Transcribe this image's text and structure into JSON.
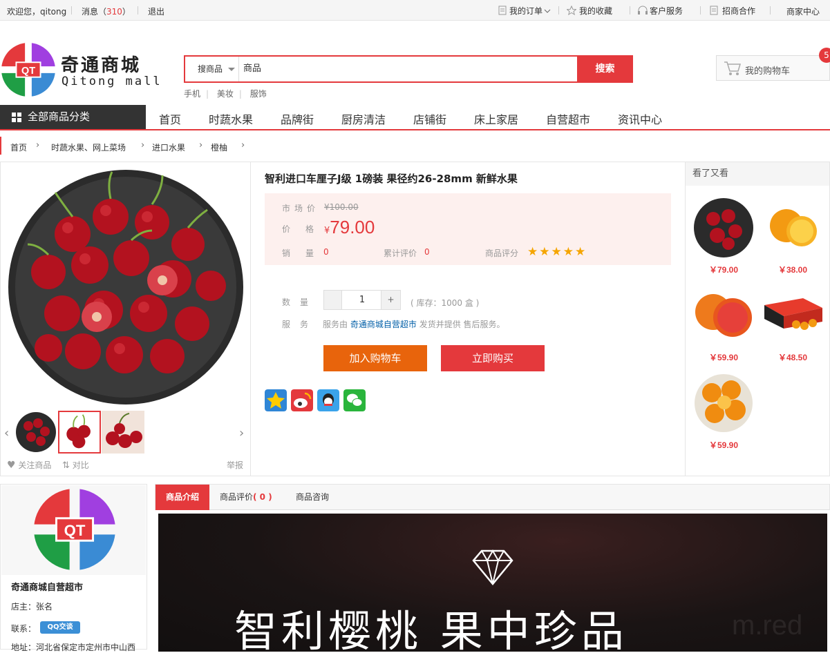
{
  "topbar": {
    "welcome": "欢迎您，qitong",
    "messages": "消息（",
    "message_count": "310",
    "messages_close": "）",
    "logout": "退出",
    "my_orders": "我的订单",
    "favorites": "我的收藏",
    "service": "客户服务",
    "partner": "招商合作",
    "merchant": "商家中心"
  },
  "logo": {
    "name": "奇通商城",
    "sub": "Qitong mall",
    "mark": "QT"
  },
  "search": {
    "category": "搜商品",
    "value": "商品",
    "button": "搜索",
    "hot": [
      "手机",
      "美妆",
      "服饰"
    ]
  },
  "cart": {
    "label": "我的购物车",
    "count": "5"
  },
  "nav": {
    "all": "全部商品分类",
    "items": [
      "首页",
      "时蔬水果",
      "品牌街",
      "厨房清洁",
      "店铺街",
      "床上家居",
      "自营超市",
      "资讯中心"
    ]
  },
  "breadcrumb": [
    "首页",
    "时蔬水果、网上菜场",
    "进口水果",
    "橙柚"
  ],
  "product": {
    "title": "智利进口车厘子J级 1磅装 果径约26-28mm 新鲜水果",
    "market_label": "市场价",
    "market_price": "¥100.00",
    "price_label": "价格",
    "currency": "¥",
    "price": "79.00",
    "sales_label": "销量",
    "sales": "0",
    "reviews_label": "累计评价",
    "reviews": "0",
    "rating_label": "商品评分",
    "rating": 5,
    "qty_label": "数量",
    "qty": "1",
    "plus": "+",
    "stock": "( 库存：1000 盒 )",
    "service_label": "服务",
    "service_pre": "服务由",
    "service_shop": "奇通商城自营超市",
    "service_post": "发货并提供 售后服务。",
    "add_cart": "加入购物车",
    "buy_now": "立即购买",
    "follow": "关注商品",
    "compare": "对比",
    "report": "举报"
  },
  "see_also": {
    "title": "看了又看",
    "items": [
      {
        "price": "￥79.00",
        "icon": "cherry-image"
      },
      {
        "price": "￥38.00",
        "icon": "orange-image"
      },
      {
        "price": "￥59.90",
        "icon": "blood-orange-image"
      },
      {
        "price": "￥48.50",
        "icon": "orange-box-image"
      },
      {
        "price": "￥59.90",
        "icon": "orange-bowl-image"
      }
    ]
  },
  "shop": {
    "name": "奇通商城自营超市",
    "owner": "店主：张名",
    "contact": "联系：",
    "qq_badge": "QQ交谈",
    "address": "地址：河北省保定市定州市中山西"
  },
  "tabs": [
    {
      "label": "商品介绍"
    },
    {
      "label": "商品评价",
      "count": "( 0 )"
    },
    {
      "label": "商品咨询"
    }
  ],
  "banner": {
    "text": "智利樱桃 果中珍品",
    "watermark": "m.red"
  },
  "colors": {
    "accent": "#e4393c",
    "cart_button": "#e8640c",
    "star": "#f5a500"
  }
}
